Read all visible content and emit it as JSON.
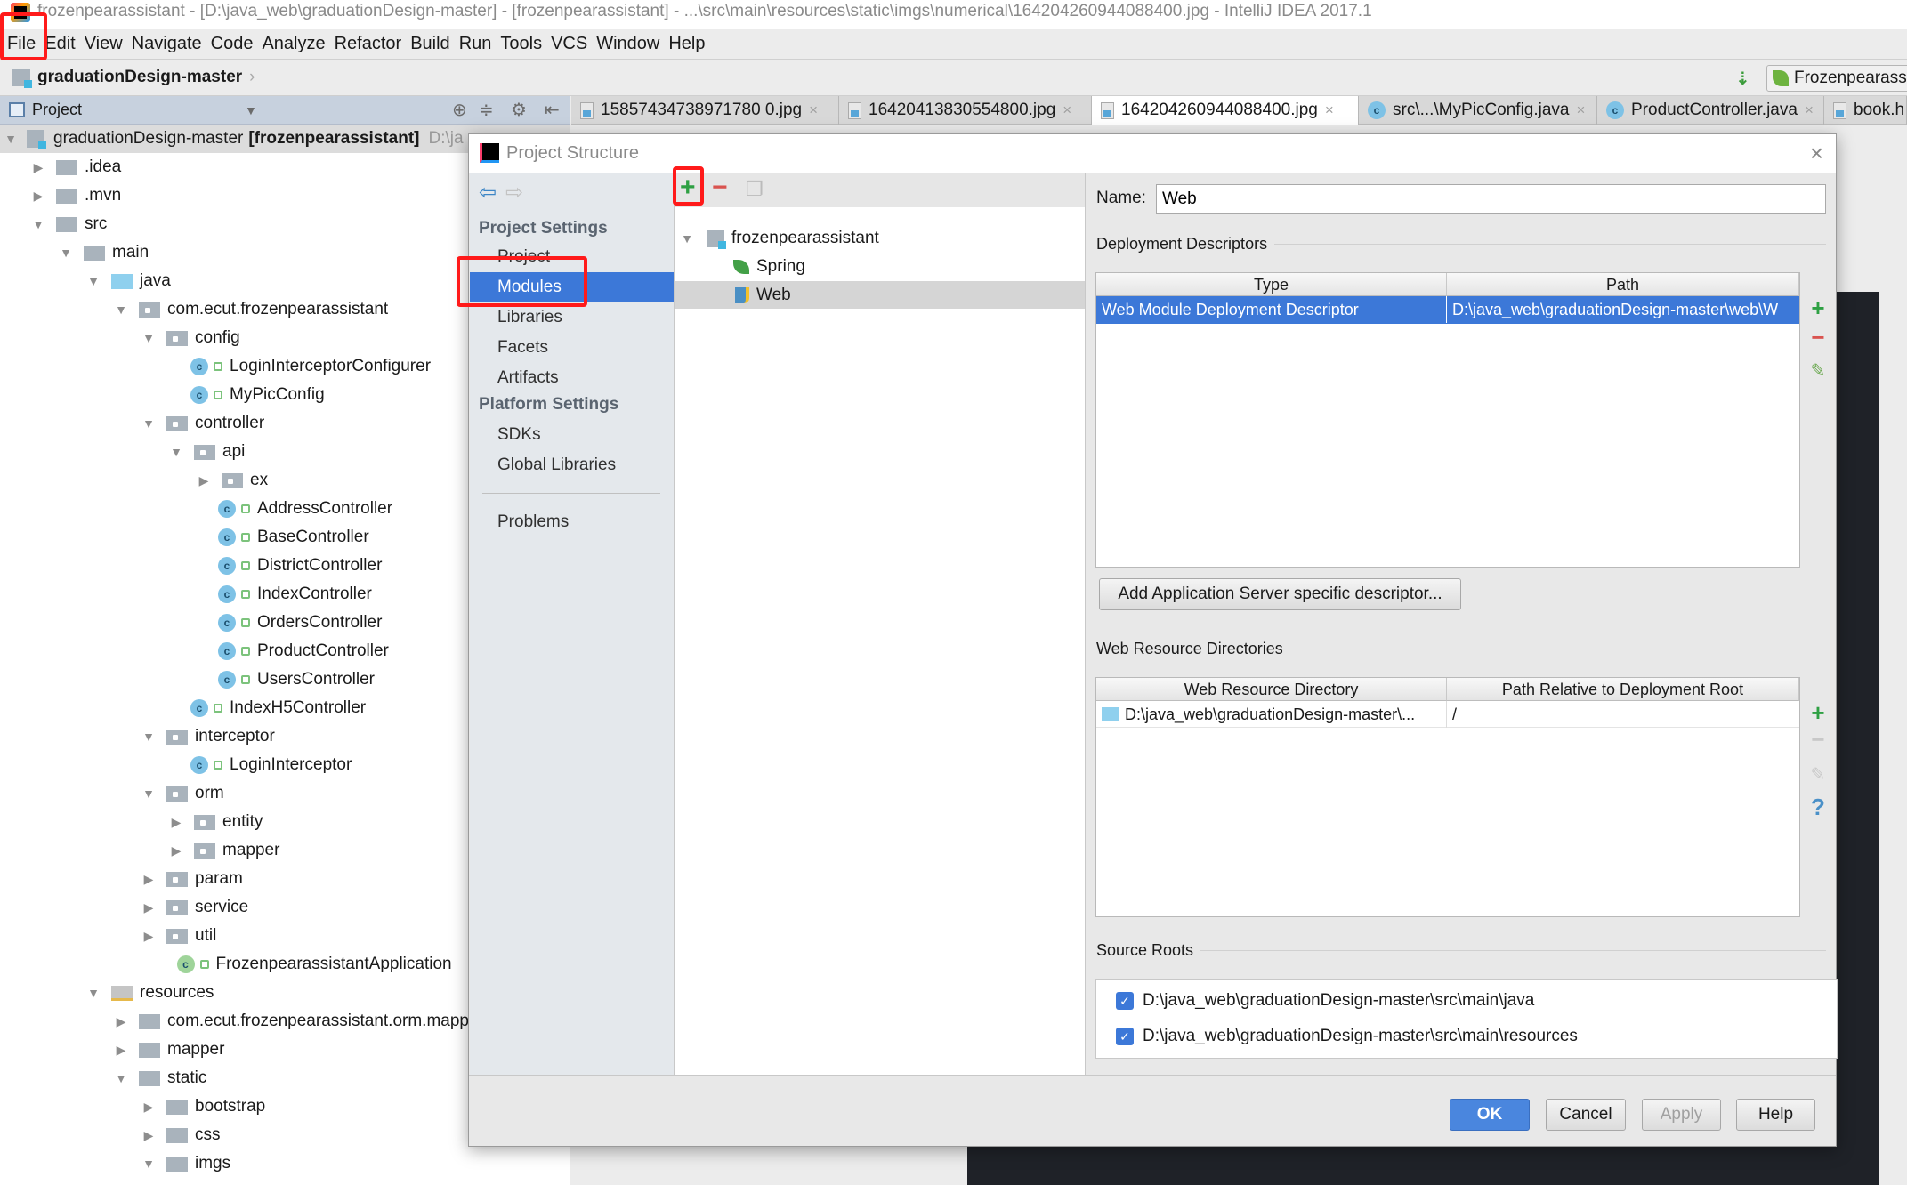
{
  "window": {
    "title": "frozenpearassistant - [D:\\java_web\\graduationDesign-master] - [frozenpearassistant] - ...\\src\\main\\resources\\static\\imgs\\numerical\\164204260944088400.jpg - IntelliJ IDEA 2017.1"
  },
  "menu": [
    "File",
    "Edit",
    "View",
    "Navigate",
    "Code",
    "Analyze",
    "Refactor",
    "Build",
    "Run",
    "Tools",
    "VCS",
    "Window",
    "Help"
  ],
  "navbar": {
    "breadcrumb": "graduationDesign-master",
    "run_config": "Frozenpearassi"
  },
  "project_panel": {
    "title": "Project"
  },
  "editor_tabs": [
    {
      "label": "15857434738971780 0.jpg",
      "type": "image"
    },
    {
      "label": "16420413830554800.jpg",
      "type": "image"
    },
    {
      "label": "164204260944088400.jpg",
      "type": "image",
      "active": true
    },
    {
      "label": "src\\...\\MyPicConfig.java",
      "type": "class"
    },
    {
      "label": "ProductController.java",
      "type": "class"
    },
    {
      "label": "book.h",
      "type": "html"
    }
  ],
  "tree": [
    {
      "label": "graduationDesign-master",
      "bold": "[frozenpearassistant]",
      "hint": "D:\\ja",
      "depth": 0,
      "exp": "open",
      "icon": "module",
      "selected": true
    },
    {
      "label": ".idea",
      "depth": 1,
      "exp": "closed",
      "icon": "folder"
    },
    {
      "label": ".mvn",
      "depth": 1,
      "exp": "closed",
      "icon": "folder"
    },
    {
      "label": "src",
      "depth": 1,
      "exp": "open",
      "icon": "folder"
    },
    {
      "label": "main",
      "depth": 2,
      "exp": "open",
      "icon": "folder"
    },
    {
      "label": "java",
      "depth": 3,
      "exp": "open",
      "icon": "source-folder"
    },
    {
      "label": "com.ecut.frozenpearassistant",
      "depth": 4,
      "exp": "open",
      "icon": "package"
    },
    {
      "label": "config",
      "depth": 5,
      "exp": "open",
      "icon": "package"
    },
    {
      "label": "LoginInterceptorConfigurer",
      "depth": 6,
      "icon": "class"
    },
    {
      "label": "MyPicConfig",
      "depth": 6,
      "icon": "class"
    },
    {
      "label": "controller",
      "depth": 5,
      "exp": "open",
      "icon": "package"
    },
    {
      "label": "api",
      "depth": 6,
      "exp": "open",
      "icon": "package"
    },
    {
      "label": "ex",
      "depth": 7,
      "exp": "closed",
      "icon": "package"
    },
    {
      "label": "AddressController",
      "depth": 7,
      "icon": "class"
    },
    {
      "label": "BaseController",
      "depth": 7,
      "icon": "class"
    },
    {
      "label": "DistrictController",
      "depth": 7,
      "icon": "class"
    },
    {
      "label": "IndexController",
      "depth": 7,
      "icon": "class"
    },
    {
      "label": "OrdersController",
      "depth": 7,
      "icon": "class"
    },
    {
      "label": "ProductController",
      "depth": 7,
      "icon": "class"
    },
    {
      "label": "UsersController",
      "depth": 7,
      "icon": "class"
    },
    {
      "label": "IndexH5Controller",
      "depth": 6,
      "icon": "class"
    },
    {
      "label": "interceptor",
      "depth": 5,
      "exp": "open",
      "icon": "package"
    },
    {
      "label": "LoginInterceptor",
      "depth": 6,
      "icon": "class"
    },
    {
      "label": "orm",
      "depth": 5,
      "exp": "open",
      "icon": "package"
    },
    {
      "label": "entity",
      "depth": 6,
      "exp": "closed",
      "icon": "package"
    },
    {
      "label": "mapper",
      "depth": 6,
      "exp": "closed",
      "icon": "package"
    },
    {
      "label": "param",
      "depth": 5,
      "exp": "closed",
      "icon": "package"
    },
    {
      "label": "service",
      "depth": 5,
      "exp": "closed",
      "icon": "package"
    },
    {
      "label": "util",
      "depth": 5,
      "exp": "closed",
      "icon": "package"
    },
    {
      "label": "FrozenpearassistantApplication",
      "depth": 5.5,
      "icon": "spring-app"
    },
    {
      "label": "resources",
      "depth": 3,
      "exp": "open",
      "icon": "resources-folder"
    },
    {
      "label": "com.ecut.frozenpearassistant.orm.mapp",
      "depth": 4,
      "exp": "closed",
      "icon": "folder"
    },
    {
      "label": "mapper",
      "depth": 4,
      "exp": "closed",
      "icon": "folder"
    },
    {
      "label": "static",
      "depth": 4,
      "exp": "open",
      "icon": "folder"
    },
    {
      "label": "bootstrap",
      "depth": 5,
      "exp": "closed",
      "icon": "folder"
    },
    {
      "label": "css",
      "depth": 5,
      "exp": "closed",
      "icon": "folder"
    },
    {
      "label": "imgs",
      "depth": 5,
      "exp": "open",
      "icon": "folder"
    }
  ],
  "dialog": {
    "title": "Project Structure",
    "nav": {
      "project_settings": "Project Settings",
      "project_items": [
        "Project",
        "Modules",
        "Libraries",
        "Facets",
        "Artifacts"
      ],
      "selected": "Modules",
      "platform_settings": "Platform Settings",
      "platform_items": [
        "SDKs",
        "Global Libraries"
      ],
      "problems": "Problems"
    },
    "modules": {
      "root": "frozenpearassistant",
      "children": [
        "Spring",
        "Web"
      ],
      "selected": "Web"
    },
    "facet": {
      "name_label": "Name:",
      "name_value": "Web",
      "deployment_title": "Deployment Descriptors",
      "deployment_columns": [
        "Type",
        "Path"
      ],
      "deployment_rows": [
        [
          "Web Module Deployment Descriptor",
          "D:\\java_web\\graduationDesign-master\\web\\W"
        ]
      ],
      "add_server_button": "Add Application Server specific descriptor...",
      "web_resource_title": "Web Resource Directories",
      "web_resource_columns": [
        "Web Resource Directory",
        "Path Relative to Deployment Root"
      ],
      "web_resource_rows": [
        [
          "D:\\java_web\\graduationDesign-master\\...",
          "/"
        ]
      ],
      "source_roots_title": "Source Roots",
      "source_roots": [
        {
          "path": "D:\\java_web\\graduationDesign-master\\src\\main\\java",
          "checked": true
        },
        {
          "path": "D:\\java_web\\graduationDesign-master\\src\\main\\resources",
          "checked": true
        }
      ]
    },
    "buttons": {
      "ok": "OK",
      "cancel": "Cancel",
      "apply": "Apply",
      "help": "Help"
    }
  },
  "colors": {
    "selection": "#3c78d8",
    "highlight_box": "#ff1a1a",
    "add": "#2ea043",
    "remove": "#d9534f"
  }
}
